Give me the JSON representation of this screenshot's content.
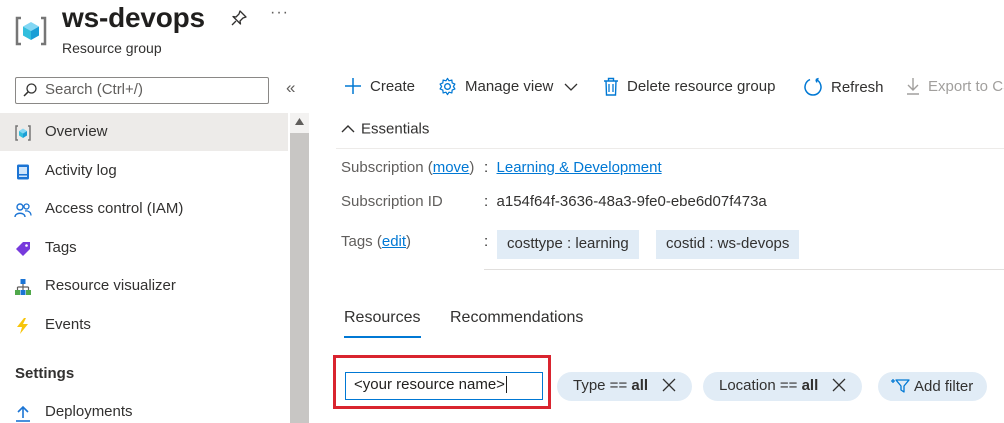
{
  "header": {
    "title": "ws-devops",
    "subtitle": "Resource group",
    "more": "···"
  },
  "search": {
    "placeholder": "Search (Ctrl+/)",
    "collapse": "«"
  },
  "sidebar": {
    "items": [
      {
        "label": "Overview",
        "icon": "resource-group-icon"
      },
      {
        "label": "Activity log",
        "icon": "activity-log-icon"
      },
      {
        "label": "Access control (IAM)",
        "icon": "people-icon"
      },
      {
        "label": "Tags",
        "icon": "tag-icon"
      },
      {
        "label": "Resource visualizer",
        "icon": "hierarchy-icon"
      },
      {
        "label": "Events",
        "icon": "lightning-icon"
      }
    ],
    "section_header": "Settings",
    "partial_item": "Deployments"
  },
  "toolbar": {
    "create": "Create",
    "manage_view": "Manage view",
    "delete": "Delete resource group",
    "refresh": "Refresh",
    "export": "Export to CSV"
  },
  "essentials": {
    "toggle": "Essentials",
    "subscription_key": "Subscription",
    "subscription_move": "move",
    "subscription_value": "Learning & Development",
    "subscription_id_key": "Subscription ID",
    "subscription_id_value": "a154f64f-3636-48a3-9fe0-ebe6d07f473a",
    "tags_key": "Tags",
    "tags_edit": "edit",
    "tags": [
      "costtype : learning",
      "costid : ws-devops"
    ]
  },
  "tabs": {
    "resources": "Resources",
    "recommendations": "Recommendations"
  },
  "filter": {
    "input_value": "<your resource name>",
    "type_label": "Type == ",
    "type_value": "all",
    "location_label": "Location == ",
    "location_value": "all",
    "add_filter": "Add filter"
  },
  "colors": {
    "accent": "#0078d4",
    "highlight": "#d9242f",
    "pill": "#e1ecf6"
  }
}
